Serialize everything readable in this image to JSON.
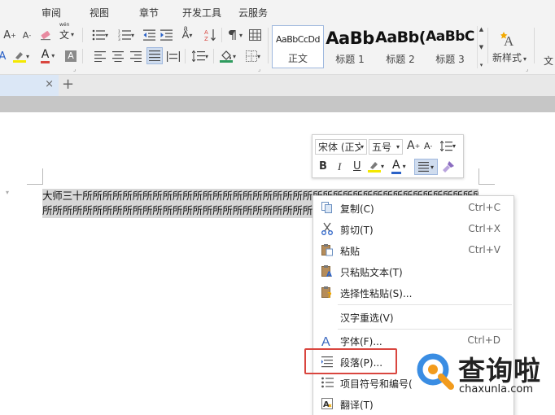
{
  "menu_tabs": [
    "审阅",
    "视图",
    "章节",
    "开发工具",
    "云服务"
  ],
  "ribbon": {
    "styles": [
      {
        "sample": "AaBbCcDd",
        "caption": "正文"
      },
      {
        "sample": "AaBb",
        "caption": "标题 1"
      },
      {
        "sample": "AaBb(",
        "caption": "标题 2"
      },
      {
        "sample": "AaBbC",
        "caption": "标题 3"
      }
    ],
    "new_style_label": "新样式",
    "new_style_arrow": "▾",
    "cut_off_label": "文",
    "glyph_font_grow": "A",
    "glyph_font_shrink": "A",
    "glyph_font_color": "A",
    "glyph_text_effect": "A",
    "glyph_char_shade": "A",
    "glyph_phonetic": "文",
    "glyph_phonetic_top": "wén"
  },
  "document_tab": {
    "close_glyph": "×",
    "new_tab_glyph": "+"
  },
  "document": {
    "line1": "大师三十所所所所所所所所所所所所所所所所所所所所所所所所所所所所所所所所所所所所所所所所所所所",
    "line2": "所所所所所所所所所所所所所所所所所所所所所所所所所所所"
  },
  "mini_toolbar": {
    "font_name": "宋体 (正文",
    "font_size": "五号",
    "bold": "B",
    "italic": "I",
    "underline": "U",
    "font_color_glyph": "A",
    "grow_glyph": "A",
    "shrink_glyph": "A",
    "dropdown_arrow": "▾"
  },
  "context_menu": {
    "items": [
      {
        "label": "复制(C)",
        "shortcut": "Ctrl+C"
      },
      {
        "label": "剪切(T)",
        "shortcut": "Ctrl+X"
      },
      {
        "label": "粘贴",
        "shortcut": "Ctrl+V"
      },
      {
        "label": "只粘贴文本(T)",
        "shortcut": ""
      },
      {
        "label": "选择性粘贴(S)...",
        "shortcut": ""
      },
      {
        "label": "汉字重选(V)",
        "shortcut": ""
      },
      {
        "label": "字体(F)...",
        "shortcut": "Ctrl+D"
      },
      {
        "label": "段落(P)...",
        "shortcut": ""
      },
      {
        "label": "项目符号和编号(",
        "shortcut": ""
      },
      {
        "label": "翻译(T)",
        "shortcut": ""
      }
    ]
  },
  "watermark": {
    "brand": "查询啦",
    "url": "chaxunla.com"
  },
  "colors": {
    "accent_blue": "#2b62c7",
    "highlight_red": "#d9463f",
    "selection_gray": "#d7d7d7",
    "watermark_blue": "#3a8de3"
  }
}
